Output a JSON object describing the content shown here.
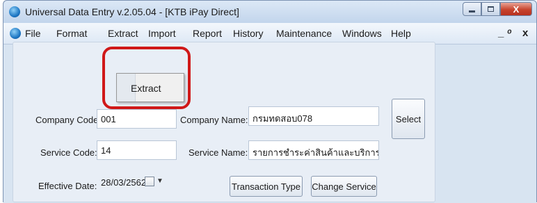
{
  "window": {
    "title": "Universal Data Entry v.2.05.04 - [KTB iPay Direct]",
    "close_glyph": "X"
  },
  "menubar": {
    "items": [
      "File",
      "Format",
      "Extract",
      "Import",
      "Report",
      "History",
      "Maintenance",
      "Windows",
      "Help"
    ],
    "mdi_minimize": "_",
    "mdi_restore": "ͦ",
    "mdi_close": "x"
  },
  "dropdown": {
    "items": [
      "Extract"
    ]
  },
  "form": {
    "company_code_label": "Company Code:",
    "company_code_value": "001",
    "company_name_label": "Company Name:",
    "company_name_value": "กรมทดสอบ078",
    "service_code_label": "Service Code:",
    "service_code_value": "14",
    "service_name_label": "Service Name:",
    "service_name_value": "รายการชำระค่าสินค้าและบริการ (Pur",
    "effective_date_label": "Effective Date:",
    "effective_date_value": "28/03/2562",
    "select_button": "Select",
    "transaction_type_button": "Transaction Type",
    "change_service_button": "Change Service"
  },
  "colors": {
    "highlight": "#d01818",
    "title_bar": "#c2d5ec",
    "close_button": "#c7442d"
  }
}
